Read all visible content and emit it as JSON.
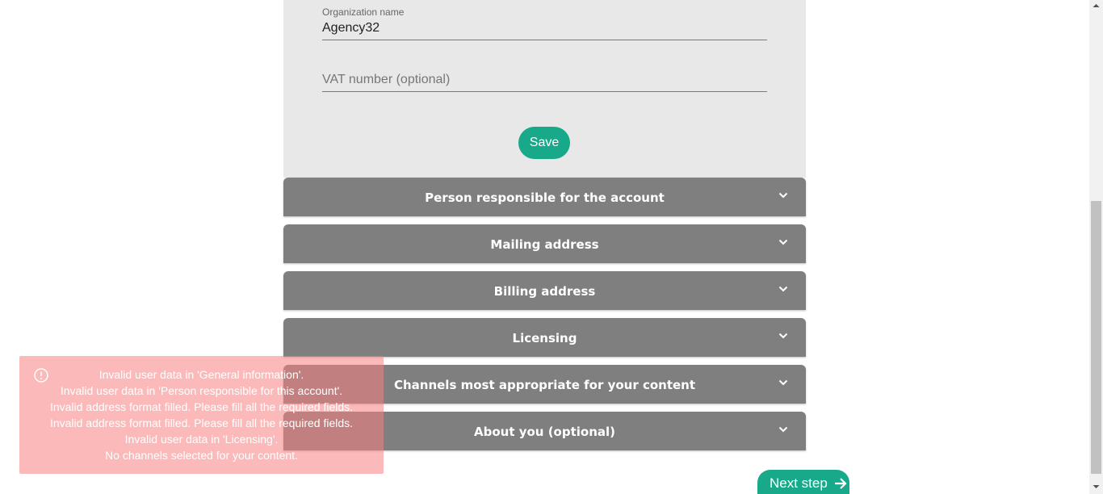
{
  "form": {
    "organization_label": "Organization name",
    "organization_value": "Agency32",
    "vat_placeholder": "VAT number (optional)",
    "vat_value": "",
    "save_label": "Save"
  },
  "sections": [
    {
      "title": "Person responsible for the account",
      "icon": "chevron-down-icon"
    },
    {
      "title": "Mailing address",
      "icon": "chevron-down-icon"
    },
    {
      "title": "Billing address",
      "icon": "chevron-down-icon"
    },
    {
      "title": "Licensing",
      "icon": "chevron-down-icon"
    },
    {
      "title": "Channels most appropriate for your content",
      "icon": "chevron-down-icon"
    },
    {
      "title": "About you (optional)",
      "icon": "chevron-down-icon"
    }
  ],
  "toast": {
    "icon": "alert-circle-icon",
    "lines": [
      "Invalid user data in 'General information'.",
      "Invalid user data in 'Person responsible for this account'.",
      "Invalid address format filled. Please fill all the required fields.",
      "Invalid address format filled. Please fill all the required fields.",
      "Invalid user data in 'Licensing'.",
      "No channels selected for your content."
    ]
  },
  "next_step": {
    "label": "Next step",
    "icon": "arrow-right-icon"
  },
  "colors": {
    "accent": "#17a98a",
    "section_bg": "#7f7f7f",
    "panel_bg": "#e8e8e8",
    "toast_bg": "#fa8080"
  }
}
